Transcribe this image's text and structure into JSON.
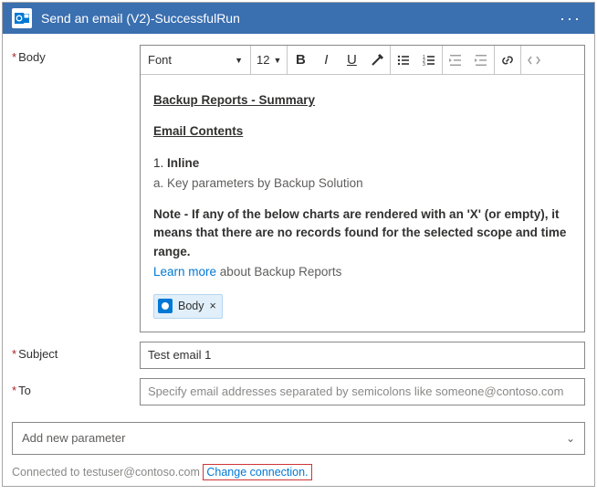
{
  "header": {
    "title": "Send an email (V2)-SuccessfulRun"
  },
  "toolbar": {
    "font_label": "Font",
    "font_size": "12"
  },
  "body": {
    "label": "Body",
    "content": {
      "title": "Backup Reports - Summary",
      "contents_heading": "Email Contents",
      "line1_num": "1.",
      "line1_text": "Inline",
      "line1a": "a. Key parameters by Backup Solution",
      "note_label": "Note",
      "note_text": " - If any of the below charts are rendered with an 'X' (or empty), it means that there are no records found for the selected scope and time range.",
      "learn_link": "Learn more",
      "learn_rest": " about Backup Reports",
      "token_label": "Body"
    }
  },
  "subject": {
    "label": "Subject",
    "value": "Test email 1"
  },
  "to": {
    "label": "To",
    "placeholder": "Specify email addresses separated by semicolons like someone@contoso.com"
  },
  "param_select": {
    "placeholder": "Add new parameter"
  },
  "footer": {
    "connected_prefix": "Connected to ",
    "connected_user": "testuser@contoso.com",
    "change_link": "Change connection."
  }
}
